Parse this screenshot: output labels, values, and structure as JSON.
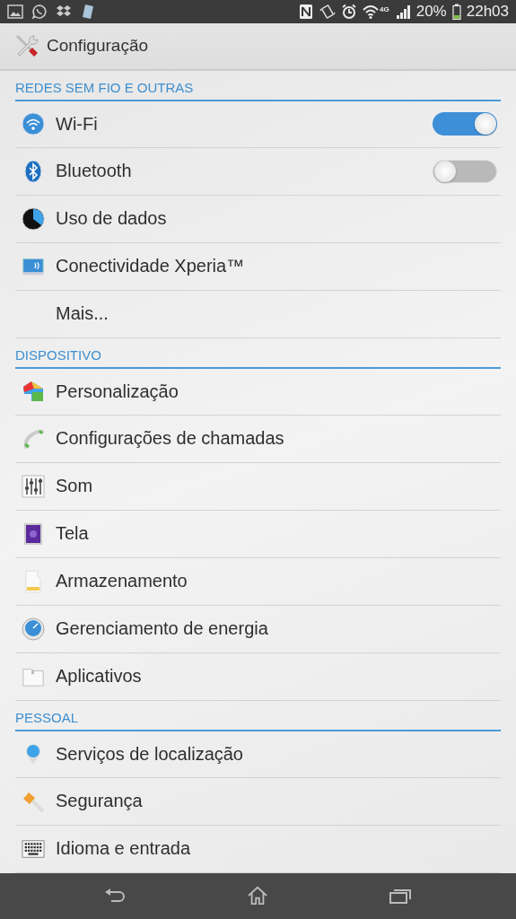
{
  "status_bar": {
    "network": "4G",
    "battery": "20%",
    "time": "22h03"
  },
  "action_bar": {
    "title": "Configuração"
  },
  "sections": [
    {
      "header": "REDES SEM FIO E OUTRAS",
      "items": [
        {
          "label": "Wi-Fi",
          "kind": "toggle",
          "on": true
        },
        {
          "label": "Bluetooth",
          "kind": "toggle",
          "on": false
        },
        {
          "label": "Uso de dados",
          "kind": "link"
        },
        {
          "label": "Conectividade Xperia™",
          "kind": "link"
        },
        {
          "label": "Mais...",
          "kind": "link"
        }
      ]
    },
    {
      "header": "DISPOSITIVO",
      "items": [
        {
          "label": "Personalização",
          "kind": "link"
        },
        {
          "label": "Configurações de chamadas",
          "kind": "link"
        },
        {
          "label": "Som",
          "kind": "link"
        },
        {
          "label": "Tela",
          "kind": "link"
        },
        {
          "label": "Armazenamento",
          "kind": "link"
        },
        {
          "label": "Gerenciamento de energia",
          "kind": "link"
        },
        {
          "label": "Aplicativos",
          "kind": "link"
        }
      ]
    },
    {
      "header": "PESSOAL",
      "items": [
        {
          "label": "Serviços de localização",
          "kind": "link"
        },
        {
          "label": "Segurança",
          "kind": "link"
        },
        {
          "label": "Idioma e entrada",
          "kind": "link"
        }
      ]
    }
  ]
}
